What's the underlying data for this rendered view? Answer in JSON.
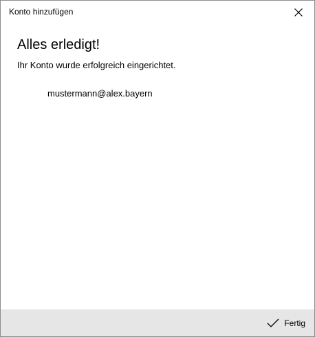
{
  "window": {
    "title": "Konto hinzufügen"
  },
  "content": {
    "heading": "Alles erledigt!",
    "subtitle": "Ihr Konto wurde erfolgreich eingerichtet.",
    "account_email": "mustermann@alex.bayern"
  },
  "footer": {
    "done_label": "Fertig",
    "done_icon": "checkmark-icon"
  },
  "icons": {
    "close": "close-icon"
  },
  "colors": {
    "footer_bg": "#e6e6e6",
    "window_bg": "#ffffff",
    "text": "#000000"
  }
}
